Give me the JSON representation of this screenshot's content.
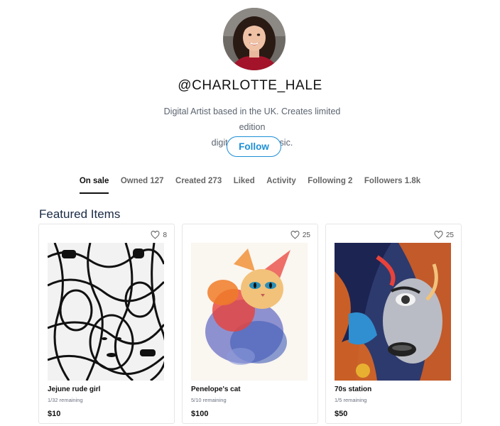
{
  "profile": {
    "handle": "@CHARLOTTE_HALE",
    "bio_line1": "Digital Artist based in the UK. Creates limited edition",
    "bio_line2": "digital art and music.",
    "follow_label": "Follow"
  },
  "tabs": [
    {
      "label": "On sale"
    },
    {
      "label": "Owned 127"
    },
    {
      "label": "Created 273"
    },
    {
      "label": "Liked"
    },
    {
      "label": "Activity"
    },
    {
      "label": "Following 2"
    },
    {
      "label": "Followers 1.8k"
    }
  ],
  "featured": {
    "title": "Featured Items",
    "items": [
      {
        "name": "Jejune rude girl",
        "remaining": "1/32 remaining",
        "price": "$10",
        "likes": "8",
        "icon": "heart-icon"
      },
      {
        "name": "Penelope's cat",
        "remaining": "5/10 remaining",
        "price": "$100",
        "likes": "25",
        "icon": "heart-icon"
      },
      {
        "name": "70s station",
        "remaining": "1/5 remaining",
        "price": "$50",
        "likes": "25",
        "icon": "heart-icon"
      }
    ]
  },
  "colors": {
    "accent": "#1d8fd6",
    "text_dark": "#111111",
    "text_muted": "#5b6470",
    "section_title": "#1a2a44",
    "border": "#e6e6e6"
  }
}
